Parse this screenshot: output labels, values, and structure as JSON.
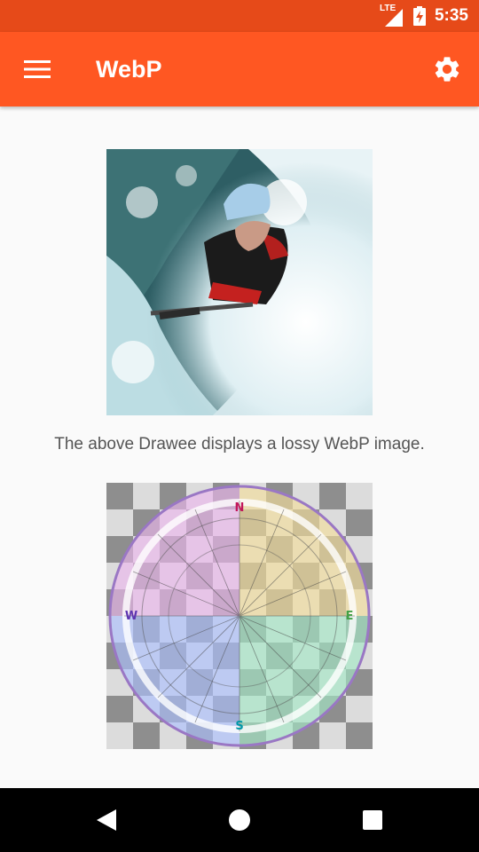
{
  "status_bar": {
    "network_label": "LTE",
    "time": "5:35",
    "icons": [
      "signal-icon",
      "battery-charging-icon"
    ]
  },
  "app_bar": {
    "title": "WebP",
    "icons": [
      "menu-icon",
      "settings-icon"
    ]
  },
  "content": {
    "caption": "The above Drawee displays a lossy WebP image."
  },
  "nav_bar": {
    "icons": [
      "back-icon",
      "home-icon",
      "recents-icon"
    ]
  },
  "colors": {
    "status_bar": "#e64a19",
    "app_bar": "#ff5722",
    "background": "#fafafa"
  }
}
